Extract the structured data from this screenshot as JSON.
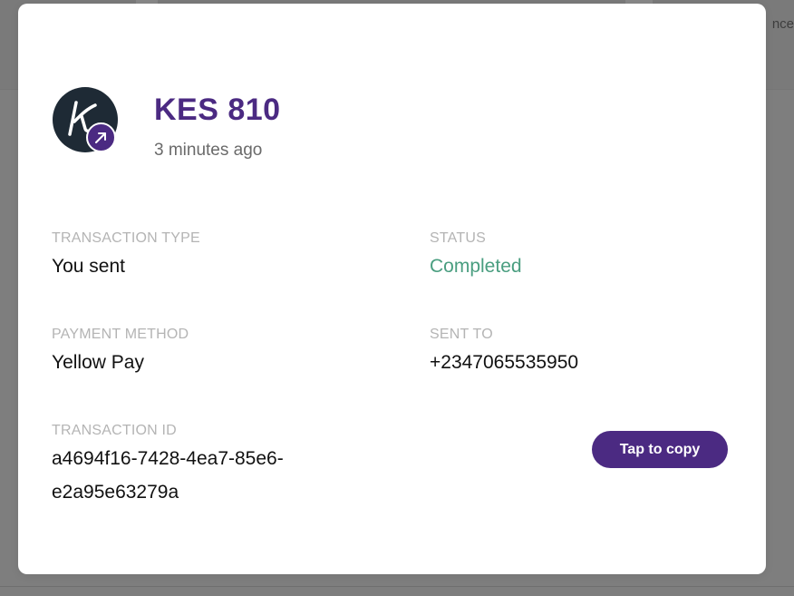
{
  "background": {
    "partial_text": "nce"
  },
  "transaction": {
    "amount": "KES 810",
    "time_ago": "3 minutes ago",
    "type_label": "TRANSACTION TYPE",
    "type_value": "You sent",
    "status_label": "STATUS",
    "status_value": "Completed",
    "method_label": "PAYMENT METHOD",
    "method_value": "Yellow Pay",
    "sent_to_label": "SENT TO",
    "sent_to_value": "+2347065535950",
    "id_label": "TRANSACTION ID",
    "id_value": "a4694f16-7428-4ea7-85e6-e2a95e63279a",
    "copy_button": "Tap to copy"
  },
  "icons": {
    "avatar": "merchant-logo-icon",
    "badge": "sent-arrow-icon"
  },
  "colors": {
    "accent": "#4b2a82",
    "status_completed": "#4a9e80",
    "overlay": "#7e7e7e",
    "avatar_bg": "#1e2a35"
  }
}
